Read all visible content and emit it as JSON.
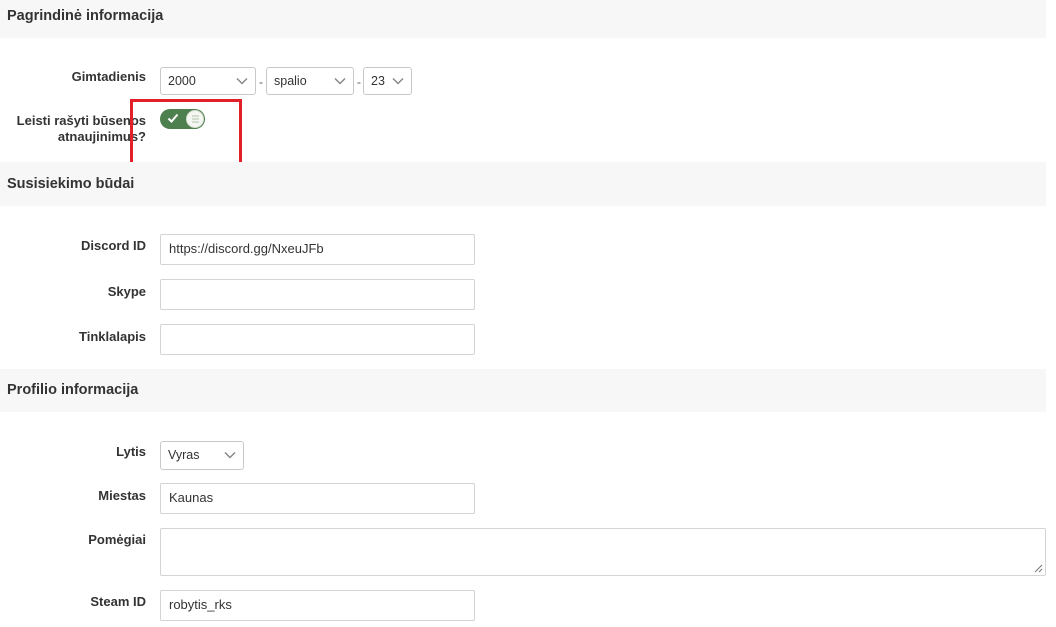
{
  "sections": {
    "basic": {
      "title": "Pagrindinė informacija"
    },
    "contacts": {
      "title": "Susisiekimo būdai"
    },
    "profile": {
      "title": "Profilio informacija"
    }
  },
  "birthday": {
    "label": "Gimtadienis",
    "year": "2000",
    "month": "spalio",
    "day": "23",
    "separator": "-"
  },
  "status_updates": {
    "label": "Leisti rašyti būsenos atnaujinimus?",
    "enabled": true
  },
  "discord": {
    "label": "Discord ID",
    "value": "https://discord.gg/NxeuJFb"
  },
  "skype": {
    "label": "Skype",
    "value": ""
  },
  "website": {
    "label": "Tinklalapis",
    "value": ""
  },
  "gender": {
    "label": "Lytis",
    "value": "Vyras"
  },
  "city": {
    "label": "Miestas",
    "value": "Kaunas"
  },
  "hobbies": {
    "label": "Pomėgiai",
    "value": ""
  },
  "steam": {
    "label": "Steam ID",
    "value": "robytis_rks"
  },
  "colors": {
    "toggle_on": "#4e7f4e",
    "highlight": "#e1202a",
    "section_bg": "#f7f7f7"
  },
  "icons": {
    "toggle_check": "check-icon",
    "toggle_knob": "lines-icon",
    "select_arrow": "chevron-down-icon"
  }
}
